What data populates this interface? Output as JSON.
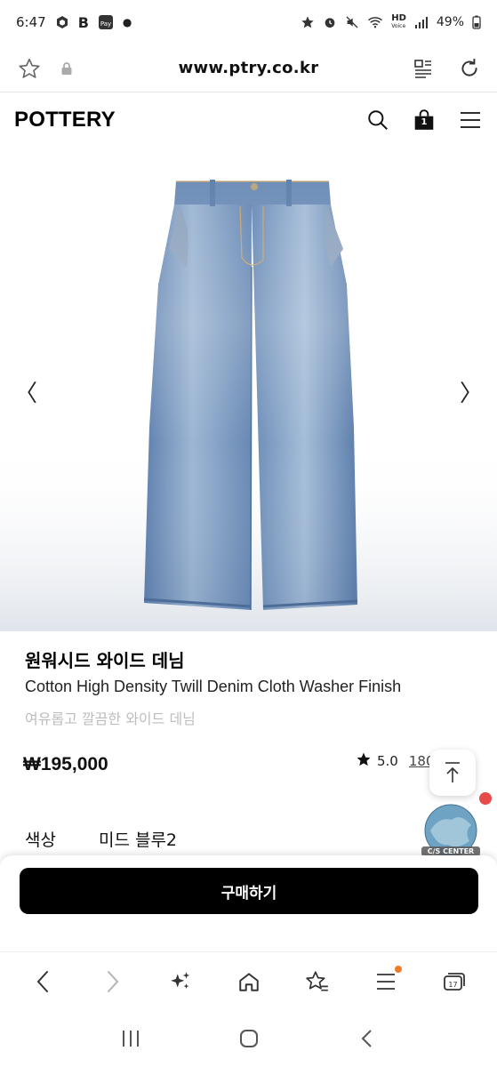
{
  "status_bar": {
    "time": "6:47",
    "b_icon": "B",
    "network_label": "HD",
    "network_sub": "Voice",
    "battery": "49%"
  },
  "browser": {
    "url": "www.ptry.co.kr"
  },
  "site": {
    "logo": "POTTERY",
    "cart_count": "1"
  },
  "gallery": {
    "prev_label": "〈",
    "next_label": "〉"
  },
  "product": {
    "name_ko": "원워시드 와이드 데님",
    "name_en": "Cotton High Density Twill Denim Cloth Washer Finish",
    "description": "여유롭고 깔끔한 와이드 데님",
    "price": "₩195,000",
    "rating": "5.0",
    "review_count": "180"
  },
  "options": {
    "color_label": "색상",
    "color_value": "미드 블루2"
  },
  "floating": {
    "cs_label": "C/S CENTER"
  },
  "buy": {
    "label": "구매하기"
  },
  "colors": {
    "accent": "#000000",
    "notification_dot": "#e84a4a",
    "toolbar_dot": "#f07a26",
    "denim": "#6f8fb8"
  },
  "icons": [
    "star-outline-icon",
    "lock-icon",
    "reader-icon",
    "refresh-icon",
    "search-icon",
    "cart-icon",
    "menu-icon",
    "back-icon",
    "forward-icon",
    "sparkle-icon",
    "home-icon",
    "bookmark-star-icon",
    "tabs-icon",
    "arrow-up-icon"
  ]
}
